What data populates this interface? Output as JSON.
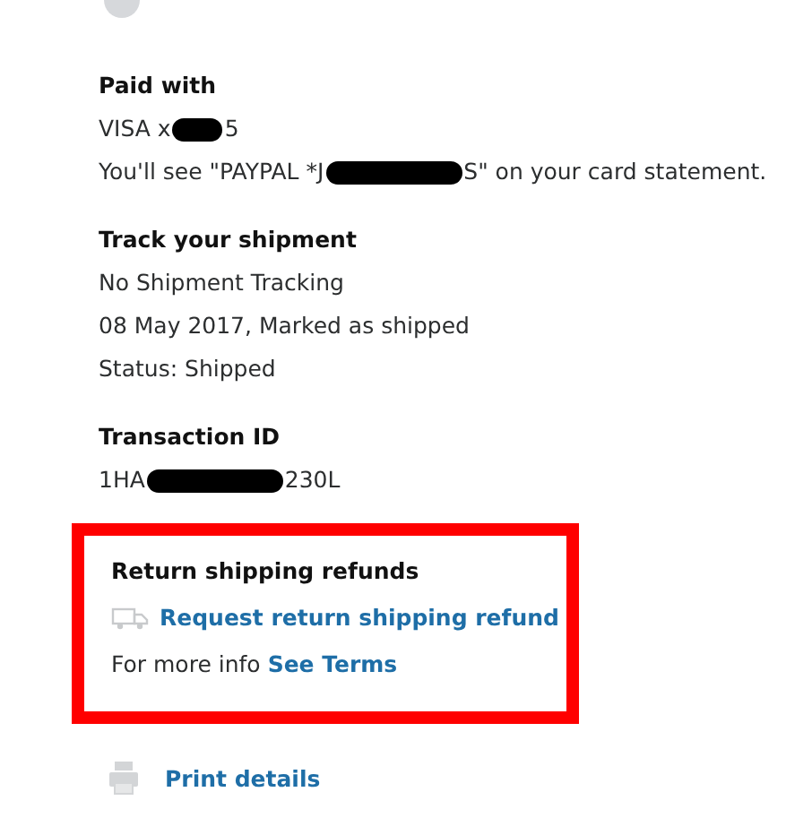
{
  "paid_with": {
    "heading": "Paid with",
    "lines": [
      [
        {
          "kind": "text",
          "text": "VISA x"
        },
        {
          "kind": "redacted"
        },
        {
          "kind": "text",
          "text": "5"
        }
      ],
      [
        {
          "kind": "text",
          "text": "You'll see \"PAYPAL *J"
        },
        {
          "kind": "redacted"
        },
        {
          "kind": "text",
          "text": "S\" on your card statement."
        }
      ]
    ]
  },
  "shipment": {
    "heading": "Track your shipment",
    "lines": [
      "No Shipment Tracking",
      "08 May 2017, Marked as shipped",
      "Status: Shipped"
    ]
  },
  "transaction": {
    "heading": "Transaction ID",
    "parts": [
      {
        "kind": "text",
        "text": "1HA"
      },
      {
        "kind": "redacted"
      },
      {
        "kind": "text",
        "text": "230L"
      }
    ]
  },
  "return_refunds": {
    "heading": "Return shipping refunds",
    "highlighted": true,
    "link": "Request return shipping refund",
    "info": "For more info",
    "terms_link": "See Terms"
  },
  "print_link": "Print details"
}
